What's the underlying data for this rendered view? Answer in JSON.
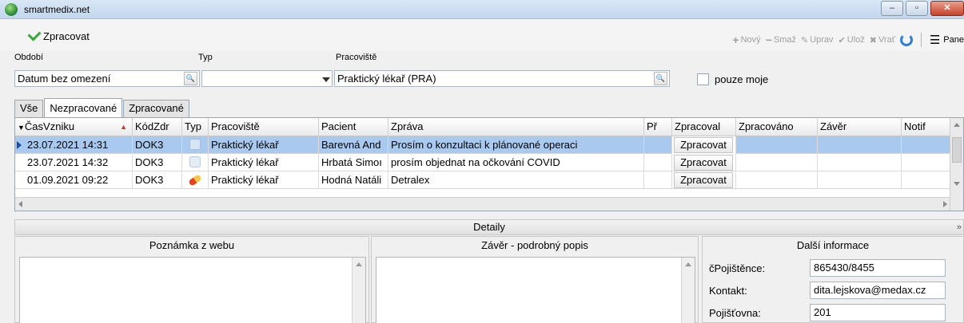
{
  "window": {
    "title": "smartmedix.net",
    "minimize": "–",
    "maximize": "▫",
    "close": "✕"
  },
  "toolbar": {
    "process_label": "Zpracovat",
    "new_label": "Nový",
    "delete_label": "Smaž",
    "edit_label": "Uprav",
    "save_label": "Ulož",
    "revert_label": "Vrať",
    "panel_label": "Pane"
  },
  "filters": {
    "period_label": "Období",
    "period_value": "Datum bez omezení",
    "type_label": "Typ",
    "type_value": "",
    "workplace_label": "Pracoviště",
    "workplace_value": "Praktický lékař (PRA)",
    "only_mine_label": "pouze moje",
    "only_mine_checked": false
  },
  "tabs": [
    {
      "label": "Vše",
      "active": false
    },
    {
      "label": "Nezpracované",
      "active": true
    },
    {
      "label": "Zpracované",
      "active": false
    }
  ],
  "grid": {
    "columns": [
      "ČasVzniku",
      "KódZdr",
      "Typ",
      "Pracoviště",
      "Pacient",
      "Zpráva",
      "Př",
      "Zpracoval",
      "Zpracováno",
      "Závěr",
      "Notif"
    ],
    "sort_indicator": "▲",
    "rows": [
      {
        "time": "23.07.2021 14:31",
        "code": "DOK3",
        "type_icon": "web-icon",
        "workplace": "Praktický lékař",
        "patient": "Barevná And",
        "message": "Prosím o konzultaci k plánované operaci",
        "attach": "",
        "processed_by": "Zpracovat",
        "processed_at": "",
        "conclusion": "",
        "notif": "",
        "selected": true
      },
      {
        "time": "23.07.2021 14:32",
        "code": "DOK3",
        "type_icon": "web-icon",
        "workplace": "Praktický lékař",
        "patient": "Hrbatá Simoı",
        "message": "prosím objednat na očkování COVID",
        "attach": "",
        "processed_by": "Zpracovat",
        "processed_at": "",
        "conclusion": "",
        "notif": "",
        "selected": false
      },
      {
        "time": "01.09.2021 09:22",
        "code": "DOK3",
        "type_icon": "pill-icon",
        "workplace": "Praktický lékař",
        "patient": "Hodná Natáli",
        "message": "Detralex",
        "attach": "",
        "processed_by": "Zpracovat",
        "processed_at": "",
        "conclusion": "",
        "notif": "",
        "selected": false
      }
    ]
  },
  "details": {
    "bar_label": "Detaily",
    "web_note_title": "Poznámka z webu",
    "conclusion_title": "Závěr - podrobný popis",
    "more_info_title": "Další informace",
    "insured_label": "čPojištěnce:",
    "insured_value": "865430/8455",
    "contact_label": "Kontakt:",
    "contact_value": "dita.lejskova@medax.cz",
    "insurer_label": "Pojišťovna:",
    "insurer_value": "201"
  },
  "colors": {
    "selection": "#a9c9ee",
    "accent_green": "#3aa63a",
    "refresh_blue": "#2f7fd6"
  }
}
